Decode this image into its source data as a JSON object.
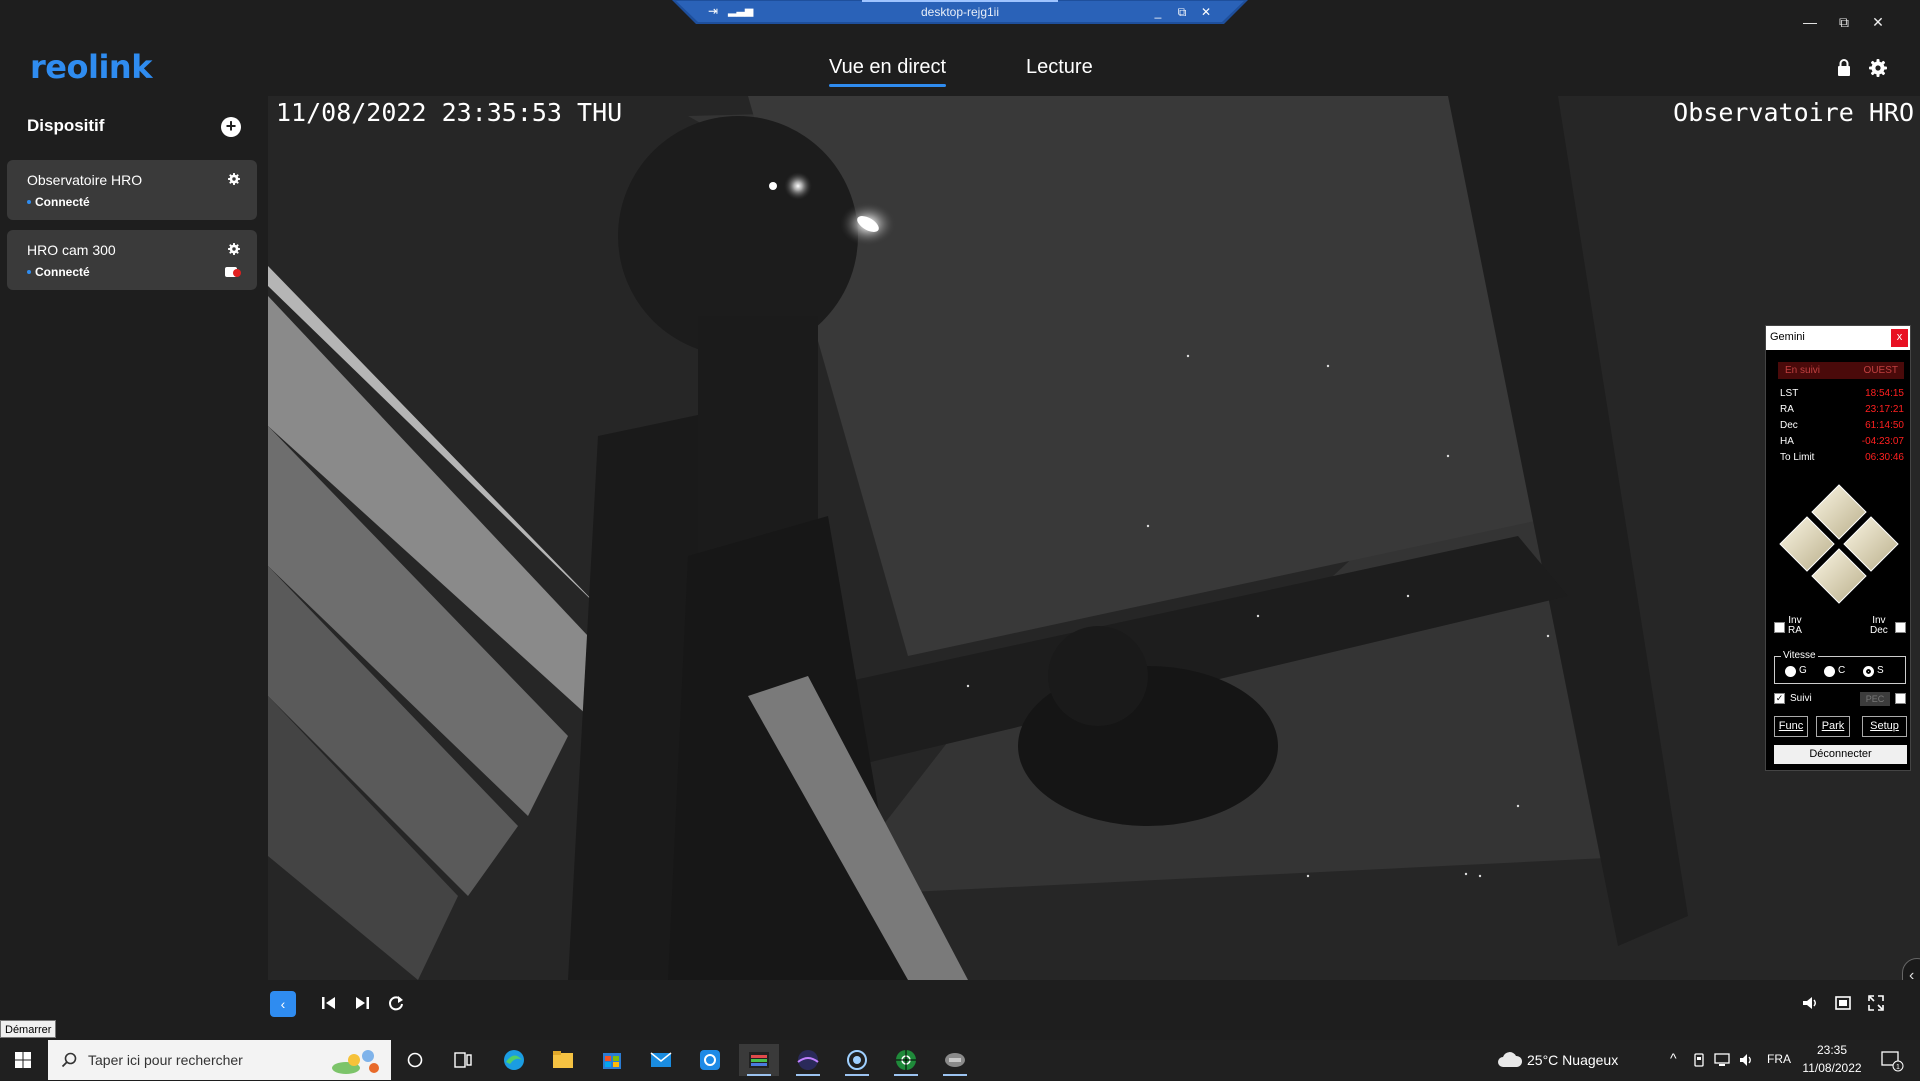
{
  "remote_desktop": {
    "host": "desktop-rejg1ii"
  },
  "window_controls": {
    "minimize": "—",
    "restore": "⧉",
    "close": "✕"
  },
  "app": {
    "brand": "reolink"
  },
  "nav": {
    "tabs": [
      {
        "label": "Vue en direct",
        "active": true
      },
      {
        "label": "Lecture",
        "active": false
      }
    ]
  },
  "sidebar": {
    "title": "Dispositif",
    "add_label": "+",
    "devices": [
      {
        "name": "Observatoire HRO",
        "status": "Connecté"
      },
      {
        "name": "HRO cam 300",
        "status": "Connecté"
      }
    ]
  },
  "osd": {
    "timestamp": "11/08/2022 23:35:53 THU",
    "camera_name": "Observatoire HRO"
  },
  "gemini": {
    "title": "Gemini",
    "close_label": "x",
    "tracking_status": "En suivi",
    "pier_side": "OUEST",
    "coords": [
      {
        "label": "LST",
        "value": "18:54:15"
      },
      {
        "label": "RA",
        "value": "23:17:21"
      },
      {
        "label": "Dec",
        "value": "61:14:50"
      },
      {
        "label": "HA",
        "value": "-04:23:07"
      },
      {
        "label": "To Limit",
        "value": "06:30:46"
      }
    ],
    "inv_ra": {
      "line1": "Inv",
      "line2": "RA"
    },
    "inv_dec": {
      "line1": "Inv",
      "line2": "Dec"
    },
    "speed": {
      "legend": "Vitesse",
      "options": [
        "G",
        "C",
        "S"
      ],
      "selected": "S"
    },
    "tracking_checkbox": {
      "label": "Suivi",
      "checked": true
    },
    "pec_label": "PEC",
    "buttons": {
      "func": "Func",
      "park": "Park",
      "setup": "Setup"
    },
    "disconnect": "Déconnecter"
  },
  "playback": {
    "collapse_label": "‹"
  },
  "tooltip": {
    "start": "Démarrer"
  },
  "taskbar": {
    "search_placeholder": "Taper ici pour rechercher",
    "weather": "25°C  Nuageux",
    "language": "FRA",
    "time": "23:35",
    "date": "11/08/2022"
  },
  "colors": {
    "accent": "#2f8cf0",
    "gemini_value": "#ff2020",
    "gemini_close": "#e81123"
  }
}
